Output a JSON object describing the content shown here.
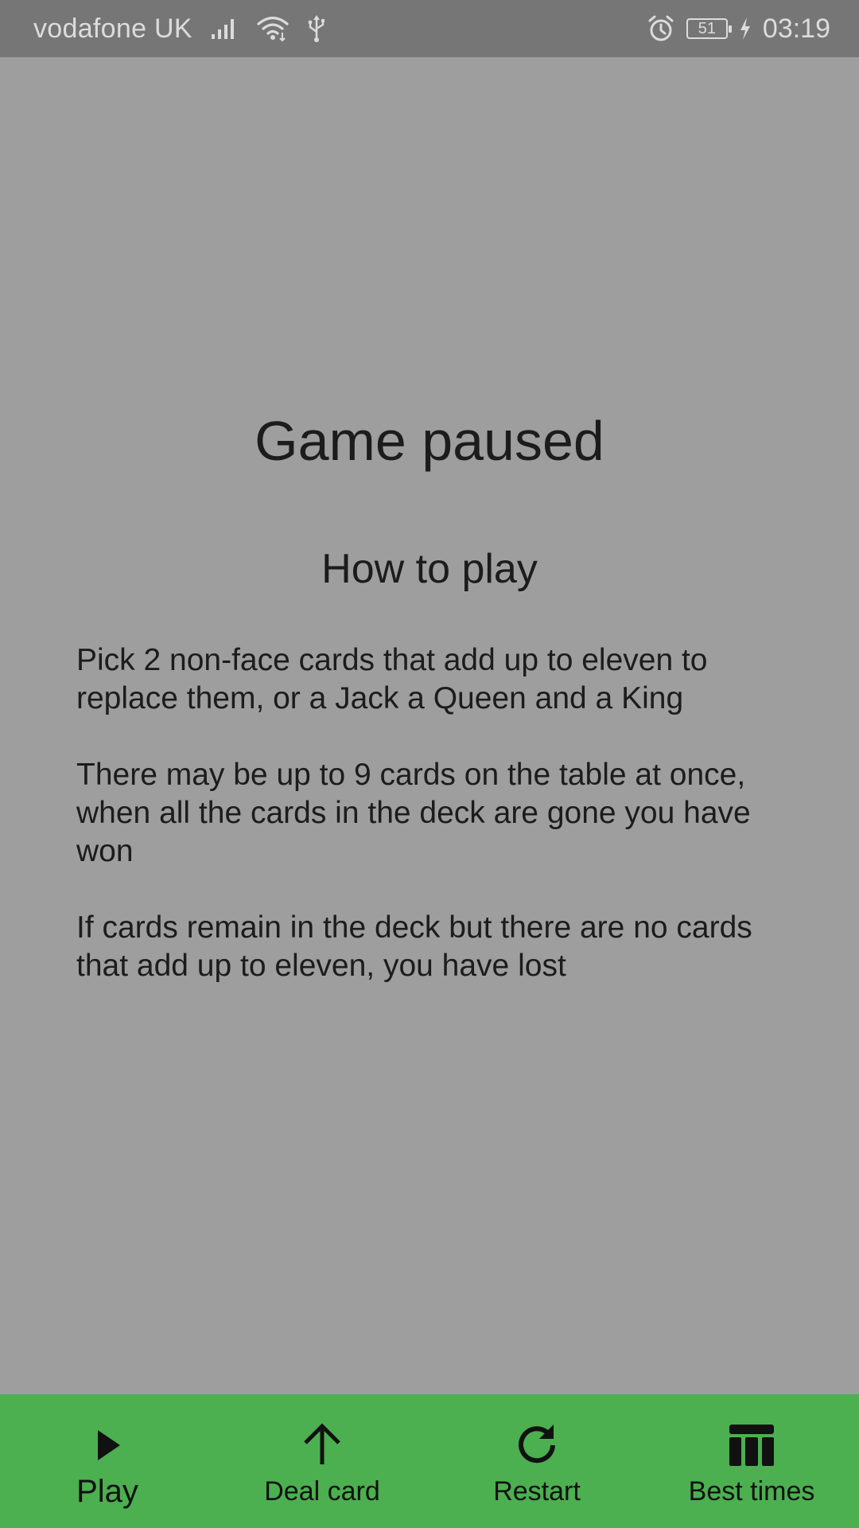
{
  "status_bar": {
    "carrier": "vodafone UK",
    "battery_level": "51",
    "time": "03:19",
    "icons": [
      "signal-icon",
      "wifi-icon",
      "usb-icon",
      "alarm-icon",
      "battery-icon",
      "charging-icon"
    ]
  },
  "pause_screen": {
    "title": "Game paused",
    "subtitle": "How to play",
    "paragraphs": [
      "Pick 2 non-face cards that add up to eleven to replace them, or a Jack a Queen and a King",
      "There may be up to 9 cards on the table at once, when all the cards in the deck are gone you have won",
      "If cards remain in the deck but there are no cards that add up to eleven, you have lost"
    ]
  },
  "bottom_nav": {
    "items": [
      {
        "label": "Play",
        "icon": "play-icon",
        "active": true
      },
      {
        "label": "Deal card",
        "icon": "arrow-up-icon",
        "active": false
      },
      {
        "label": "Restart",
        "icon": "restart-icon",
        "active": false
      },
      {
        "label": "Best times",
        "icon": "table-icon",
        "active": false
      }
    ]
  },
  "colors": {
    "overlay_background": "#9e9e9e",
    "status_bar": "#767676",
    "bottom_bar": "#4caf50",
    "text": "#1c1c1c"
  }
}
